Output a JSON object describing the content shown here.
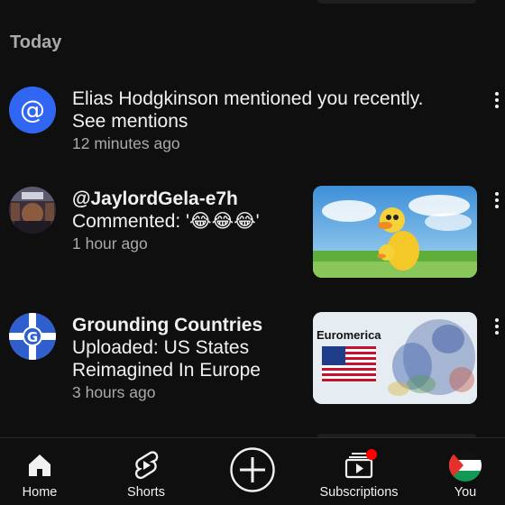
{
  "section": {
    "title": "Today"
  },
  "notifications": [
    {
      "icon": "at-sign-icon",
      "line1": "Elias Hodgkinson mentioned you recently.",
      "line2": "See mentions",
      "time": "12 minutes ago"
    },
    {
      "icon": "user-avatar",
      "name": "@JaylordGela-e7h",
      "line1": "Commented: '😂😂😂'",
      "time": "1 hour ago",
      "thumbnail": "cartoon-ducks-thumbnail"
    },
    {
      "icon": "channel-avatar",
      "name": "Grounding Countries",
      "line1": "Uploaded: US States",
      "line2": "Reimagined In Europe",
      "time": "3 hours ago",
      "thumbnail_title": "Euromerica"
    }
  ],
  "nav": {
    "home": "Home",
    "shorts": "Shorts",
    "create": "create-icon",
    "subscriptions": "Subscriptions",
    "you": "You"
  },
  "colors": {
    "background": "#0f0f0f",
    "accent_blue": "#3166f2",
    "badge_red": "#ff0000"
  }
}
